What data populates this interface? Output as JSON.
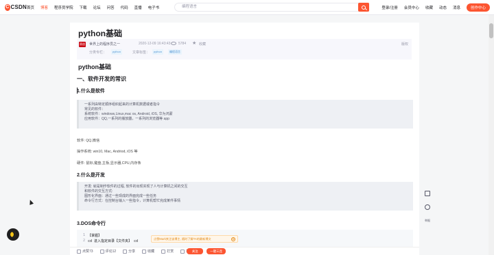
{
  "nav": {
    "logo_text": "CSDN",
    "links": [
      "首页",
      "博客",
      "程序员学院",
      "下载",
      "论坛",
      "问答",
      "代码",
      "直播",
      "电子书"
    ],
    "search_placeholder": "编程语言",
    "right_links": [
      "登录/注册",
      "会员中心",
      "收藏",
      "动态",
      "消息"
    ],
    "create_button": "创作中心"
  },
  "article": {
    "title": "python基础",
    "original_badge": "原创",
    "author": "世界上的程序员之一",
    "date": "2020-12-09 16:43:43",
    "views": "5784",
    "favorite": "收藏",
    "copyright": "版权",
    "category_label": "分类专栏：",
    "category": "python",
    "tags_label": "文章标签：",
    "tags": [
      "python",
      "编程语言"
    ],
    "h1": "python基础",
    "h2": "一、软件开发的常识",
    "s1_heading": "1.什么是软件",
    "s1_quote": [
      "一系列由特定顺序组织起来的计算机数据或者指令",
      "常见的软件：",
      "  系统软件：windows,Linux,mac os, Android, iOS, 华为鸿蒙",
      "  应用软件：QQ,一系列的播放器，一系列的浏览器等 app"
    ],
    "para1": "软件: QQ,微信",
    "para2": "操作系统: win10, Mac, Andriod, iOS 等",
    "para3": "硬件: 鼠标,键盘,主板,显示器,CPU,内存条",
    "s2_heading": "2.什么是开发",
    "s2_quote": [
      "开发: 就是制作软件的过程, 软件的出现实现了人与计算机之间的交互",
      "和软件的交互方式:",
      "  图形化界面：通过一些现成的界面完成一些任务",
      "  命令行方式：在控制台输入一些指令，计算机帮忙完成某件事情"
    ],
    "s3_heading": "3.DOS命令行",
    "code_lines": [
      {
        "n": "1",
        "text": "【掌握】"
      },
      {
        "n": "2",
        "text": "cd   进入指定目录【文件夹】    cd"
      }
    ]
  },
  "toast": {
    "text": "点赞Mark关注该博主, 随时了解TA的最新博文",
    "close": "⊗"
  },
  "toolbar": {
    "like": "点赞73",
    "comment": "评论12",
    "share": "分享",
    "collect": "收藏",
    "reward": "打赏",
    "report": "举报",
    "follow": "关注",
    "triple": "一键三连"
  },
  "side": {
    "feedback_label": "举报"
  }
}
